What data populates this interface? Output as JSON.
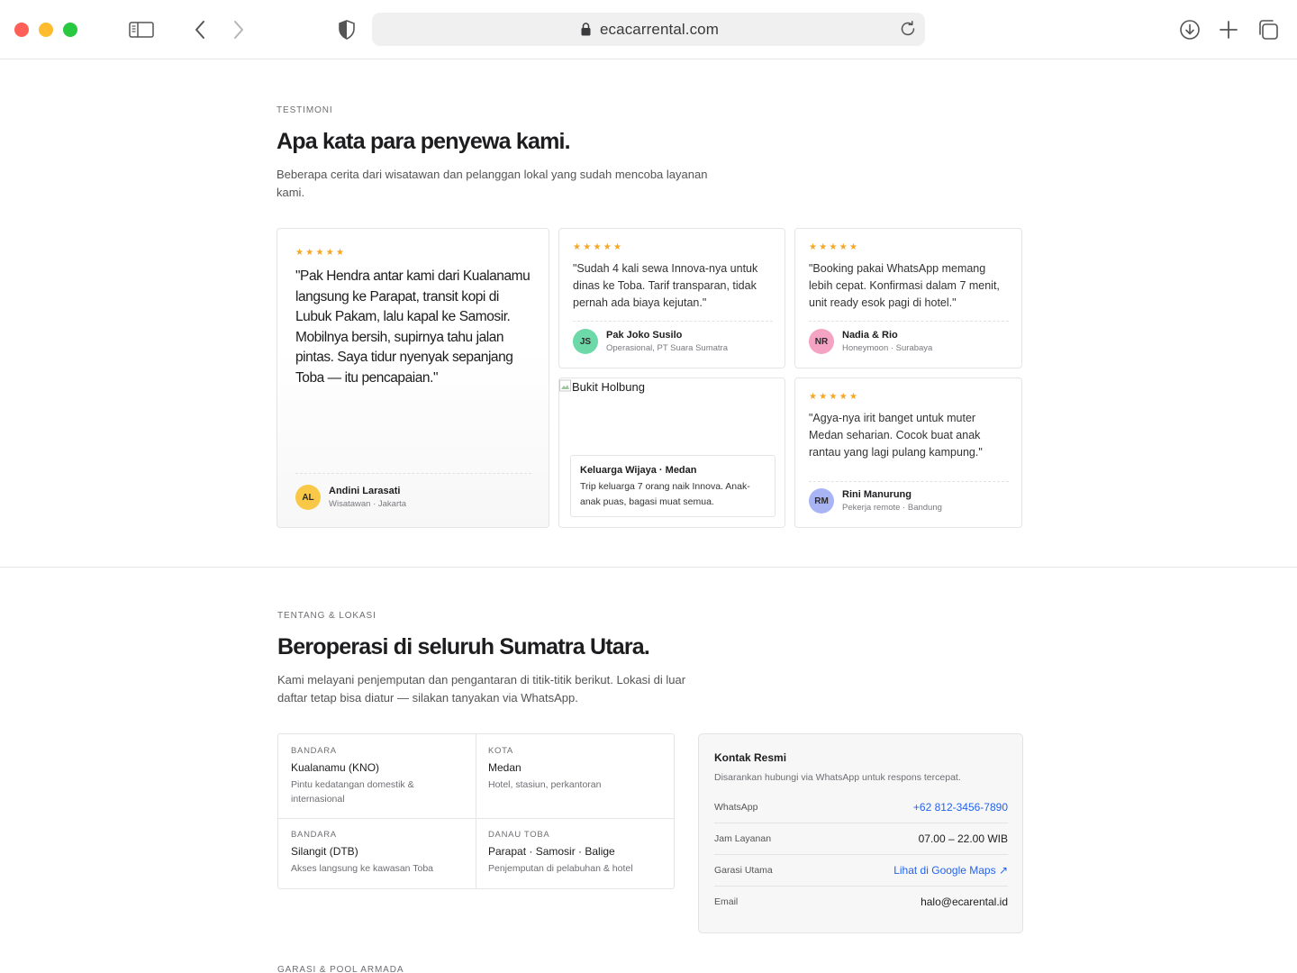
{
  "browser": {
    "url": "ecacarrental.com"
  },
  "testimonials": {
    "eyebrow": "TESTIMONI",
    "title": "Apa kata para penyewa kami.",
    "lead": "Beberapa cerita dari wisatawan dan pelanggan lokal yang sudah mencoba layanan kami.",
    "stars": "★★★★★",
    "featured": {
      "quote": "\"Pak Hendra antar kami dari Kualanamu langsung ke Parapat, transit kopi di Lubuk Pakam, lalu kapal ke Samosir. Mobilnya bersih, supirnya tahu jalan pintas. Saya tidur nyenyak sepanjang Toba — itu pencapaian.\"",
      "initials": "AL",
      "name": "Andini Larasati",
      "role": "Wisatawan · Jakarta",
      "avatar_color": "#f9c846"
    },
    "items": [
      {
        "quote": "\"Sudah 4 kali sewa Innova-nya untuk dinas ke Toba. Tarif transparan, tidak pernah ada biaya kejutan.\"",
        "initials": "JS",
        "name": "Pak Joko Susilo",
        "role": "Operasional, PT Suara Sumatra",
        "avatar_color": "#6dd9a8"
      },
      {
        "quote": "\"Booking pakai WhatsApp memang lebih cepat. Konfirmasi dalam 7 menit, unit ready esok pagi di hotel.\"",
        "initials": "NR",
        "name": "Nadia & Rio",
        "role": "Honeymoon · Surabaya",
        "avatar_color": "#f4a3c3"
      },
      {
        "quote": "\"Agya-nya irit banget untuk muter Medan seharian. Cocok buat anak rantau yang lagi pulang kampung.\"",
        "initials": "RM",
        "name": "Rini Manurung",
        "role": "Pekerja remote · Bandung",
        "avatar_color": "#a9b4f5"
      }
    ],
    "photo": {
      "alt": "Bukit Holbung",
      "title": "Keluarga Wijaya · Medan",
      "text": "Trip keluarga 7 orang naik Innova. Anak-anak puas, bagasi muat semua."
    }
  },
  "about": {
    "eyebrow": "TENTANG & LOKASI",
    "title": "Beroperasi di seluruh Sumatra Utara.",
    "lead": "Kami melayani penjemputan dan pengantaran di titik-titik berikut. Lokasi di luar daftar tetap bisa diatur — silakan tanyakan via WhatsApp.",
    "locations": [
      {
        "type": "BANDARA",
        "name": "Kualanamu (KNO)",
        "desc": "Pintu kedatangan domestik & internasional"
      },
      {
        "type": "KOTA",
        "name": "Medan",
        "desc": "Hotel, stasiun, perkantoran"
      },
      {
        "type": "BANDARA",
        "name": "Silangit (DTB)",
        "desc": "Akses langsung ke kawasan Toba"
      },
      {
        "type": "DANAU TOBA",
        "name": "Parapat · Samosir · Balige",
        "desc": "Penjemputan di pelabuhan & hotel"
      }
    ],
    "contact": {
      "title": "Kontak Resmi",
      "subtitle": "Disarankan hubungi via WhatsApp untuk respons tercepat.",
      "rows": [
        {
          "label": "WhatsApp",
          "value": "+62 812-3456-7890"
        },
        {
          "label": "Jam Layanan",
          "value": "07.00 – 22.00 WIB"
        },
        {
          "label": "Garasi Utama",
          "value": "Lihat di Google Maps ↗"
        },
        {
          "label": "Email",
          "value": "halo@ecarental.id"
        }
      ]
    }
  },
  "next_section": {
    "eyebrow": "GARASI & POOL ARMADA"
  }
}
